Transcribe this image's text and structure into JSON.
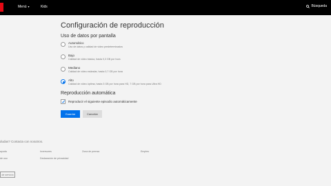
{
  "header": {
    "menu_label": "Menú",
    "menu_caret": "▾",
    "kids_label": "Kids",
    "search_label": "Búsqueda"
  },
  "main": {
    "title": "Configuración de reproducción",
    "data_usage_heading": "Uso de datos por pantalla",
    "options": [
      {
        "title": "Automático",
        "description": "Uso de datos y calidad de video predeterminados",
        "selected": false
      },
      {
        "title": "Bajo",
        "description": "Calidad de video básica, hasta 0,3 GB por hora",
        "selected": false
      },
      {
        "title": "Mediano",
        "description": "Calidad de video estándar, hasta 0,7 GB por hora",
        "selected": false
      },
      {
        "title": "Alto",
        "description": "Calidad de video óptima, hasta 3 GB por hora para HD, 7 GB por hora para Ultra HD",
        "selected": true
      }
    ],
    "autoplay_heading": "Reproducción automática",
    "autoplay_checkbox_label": "Reproducir el siguiente episodio automáticamente",
    "autoplay_checked": true,
    "save_label": "Guardar",
    "cancel_label": "Cancelar"
  },
  "footer": {
    "question": "dudas? Contacta con nosotros.",
    "links": [
      "ayuda",
      "Inversores",
      "Zona de prensa",
      "Empleo",
      "de uso",
      "Declaración de privacidad"
    ],
    "service_button": "de servicio"
  },
  "colors": {
    "accent": "#0071eb",
    "brand": "#e50914",
    "topbar": "#000000",
    "background": "#f3f3f3"
  }
}
